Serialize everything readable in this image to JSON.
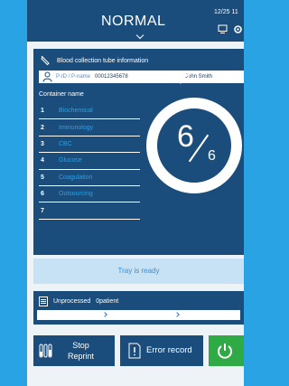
{
  "header": {
    "mode": "NORMAL",
    "clock": "12/25 11"
  },
  "panel": {
    "title": "Blood collection tube information",
    "patient": {
      "id_placeholder": "P-ID / P-name",
      "id": "00012345678",
      "name": "John Smith"
    },
    "container_label": "Container name",
    "containers": [
      {
        "num": "1",
        "name": "Biochemical"
      },
      {
        "num": "2",
        "name": "Immunology"
      },
      {
        "num": "3",
        "name": "CBC"
      },
      {
        "num": "4",
        "name": "Glucose"
      },
      {
        "num": "5",
        "name": "Coagulation"
      },
      {
        "num": "6",
        "name": "Outsourcing"
      },
      {
        "num": "7",
        "name": ""
      }
    ],
    "counter": {
      "current": "6",
      "total": "6"
    }
  },
  "tray_status": "Tray is ready",
  "unprocessed": {
    "label": "Unprocessed",
    "count_label": "0patient"
  },
  "buttons": {
    "stop_line1": "Stop",
    "stop_line2": "Reprint",
    "error_record": "Error record"
  },
  "icons": {
    "tube": "test-tube-icon",
    "monitor": "monitor-icon",
    "gear": "gear-icon",
    "person": "person-icon",
    "pencil": "pencil-icon",
    "list": "list-icon",
    "error": "error-record-icon",
    "power": "power-icon"
  },
  "colors": {
    "navy": "#1a4d7c",
    "accent_blue": "#2d9fe3",
    "background": "#29a3e3",
    "power_green": "#2faa44",
    "tray_bg": "#c6e2f4"
  }
}
